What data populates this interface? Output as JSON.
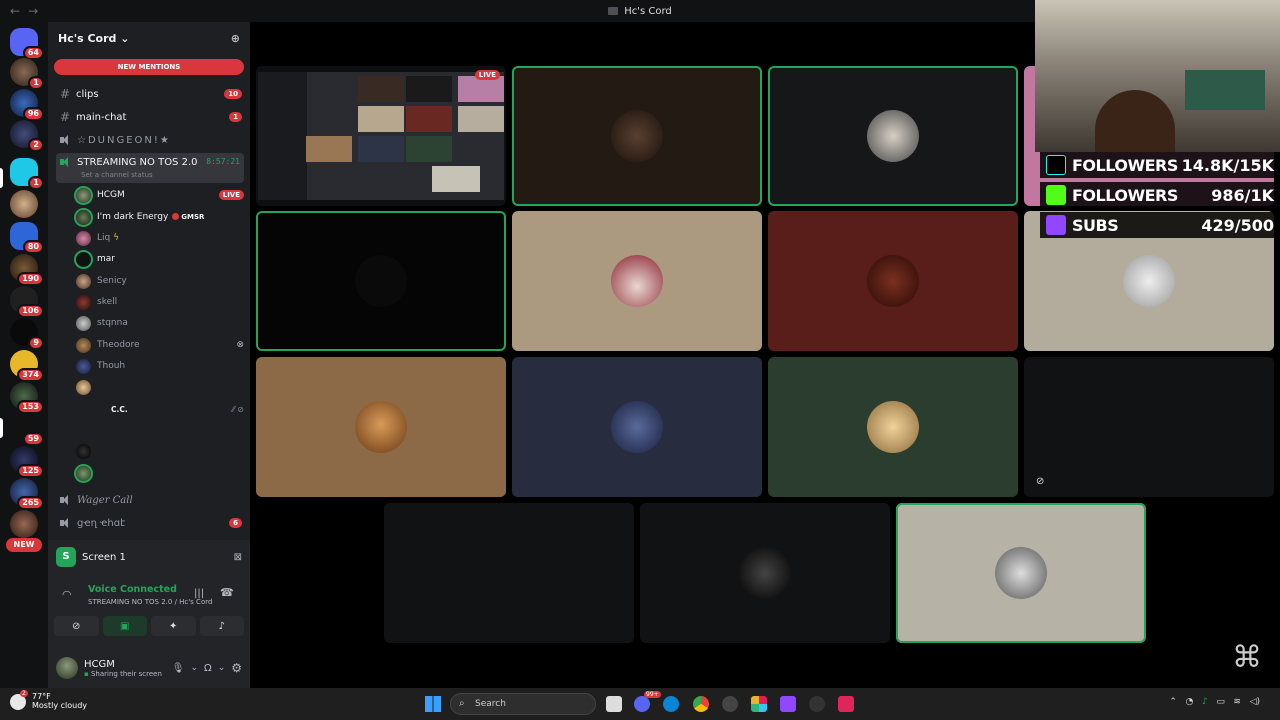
{
  "window": {
    "title": "Hc's Cord"
  },
  "guild": {
    "name": "Hc's Cord",
    "new_mentions": "NEW MENTIONS"
  },
  "server_badges": [
    "64",
    "1",
    "96",
    "2",
    "1",
    "",
    "80",
    "190",
    "106",
    "9",
    "374",
    "153",
    "59",
    "125",
    "265"
  ],
  "new_badge": "NEW",
  "channels": {
    "clips": {
      "name": "clips",
      "count": "10"
    },
    "main_chat": {
      "name": "main-chat",
      "count": "1"
    },
    "dungeon": {
      "name": "☆DUNGEON!★"
    },
    "streaming": {
      "name": "STREAMING NO TOS 2.0",
      "timer": "8:57:21",
      "status": "Set a channel status"
    },
    "wager": {
      "name": "Wager Call"
    },
    "gen": {
      "name": "ցҽղ ҽհɑէ",
      "count": "6"
    }
  },
  "voice_users": [
    {
      "name": "HCGM",
      "live": "LIVE"
    },
    {
      "name": "I'm dark Energy",
      "tag": "GMSR"
    },
    {
      "name": "Liq"
    },
    {
      "name": "mar"
    },
    {
      "name": "Senicy"
    },
    {
      "name": "skell"
    },
    {
      "name": "stqnna"
    },
    {
      "name": "Theodore"
    },
    {
      "name": "Thouh"
    },
    {
      "name": ""
    },
    {
      "name": "C.C."
    }
  ],
  "panel": {
    "screen_label": "Screen 1",
    "voice_connected": "Voice Connected",
    "voice_channel": "STREAMING NO TOS 2.0 / Hc's Cord",
    "user_name": "HCGM",
    "user_status": "Sharing their screen"
  },
  "stream": {
    "live_badge": "LIVE"
  },
  "overlay": {
    "tiktok": {
      "label": "FOLLOWERS",
      "value": "14.8K/15K"
    },
    "kick": {
      "label": "FOLLOWERS",
      "value": "986/1K"
    },
    "twitch": {
      "label": "SUBS",
      "value": "429/500"
    }
  },
  "taskbar": {
    "temperature": "77°F",
    "weather": "Mostly cloudy",
    "weather_badge": "2",
    "search_placeholder": "Search",
    "app_badge": "99+"
  },
  "colors": {
    "accent_green": "#23a55a",
    "alert_red": "#da373c",
    "bg_dark": "#1e1f22"
  }
}
